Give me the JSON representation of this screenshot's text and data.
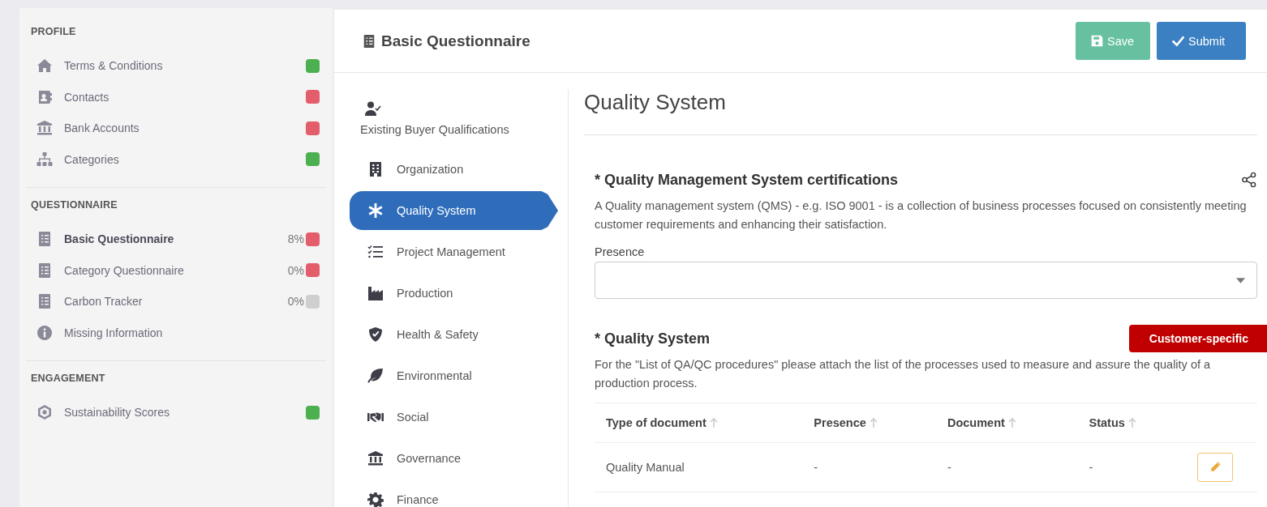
{
  "sidebar": {
    "sections": [
      {
        "title": "PROFILE",
        "items": [
          {
            "label": "Terms & Conditions",
            "selected": false,
            "color": "#4caf50"
          },
          {
            "label": "Contacts",
            "selected": false,
            "color": "#e35d6a"
          },
          {
            "label": "Bank Accounts",
            "selected": false,
            "color": "#e35d6a"
          },
          {
            "label": "Categories",
            "selected": false,
            "color": "#4caf50"
          }
        ]
      },
      {
        "title": "QUESTIONNAIRE",
        "items": [
          {
            "label": "Basic Questionnaire",
            "selected": true,
            "percent": "8%",
            "color": "#e35d6a"
          },
          {
            "label": "Category Questionnaire",
            "selected": false,
            "percent": "0%",
            "color": "#e35d6a"
          },
          {
            "label": "Carbon Tracker",
            "selected": false,
            "percent": "0%",
            "color": "#cfcfcf"
          },
          {
            "label": "Missing Information",
            "selected": false
          }
        ]
      },
      {
        "title": "ENGAGEMENT",
        "items": [
          {
            "label": "Sustainability Scores",
            "selected": false,
            "color": "#4caf50"
          }
        ]
      }
    ]
  },
  "header": {
    "title": "Basic Questionnaire",
    "buttons": [
      {
        "kind": "save",
        "label": "Save"
      },
      {
        "kind": "submit",
        "label": "Submit"
      }
    ]
  },
  "nav": [
    {
      "kind": "stacked",
      "label": "Existing Buyer Qualifications",
      "selected": false
    },
    {
      "kind": "row",
      "label": "Organization",
      "selected": false
    },
    {
      "kind": "row",
      "label": "Quality System",
      "selected": true
    },
    {
      "kind": "row",
      "label": "Project Management",
      "selected": false
    },
    {
      "kind": "row",
      "label": "Production",
      "selected": false
    },
    {
      "kind": "row",
      "label": "Health & Safety",
      "selected": false
    },
    {
      "kind": "row",
      "label": "Environmental",
      "selected": false
    },
    {
      "kind": "row",
      "label": "Social",
      "selected": false
    },
    {
      "kind": "row",
      "label": "Governance",
      "selected": false
    },
    {
      "kind": "row",
      "label": "Finance",
      "selected": false
    }
  ],
  "content": {
    "title": "Quality System",
    "sections": [
      {
        "title": "* Quality Management System certifications",
        "description": "A Quality management system (QMS) - e.g. ISO 9001 - is a collection of business processes focused on consistently meeting customer requirements and enhancing their satisfaction.",
        "field": {
          "label": "Presence"
        }
      },
      {
        "title": "* Quality System",
        "badge": "Customer-specific",
        "description": "For the \"List of QA/QC procedures\" please attach the list of the processes used to measure and assure the quality of a production process.",
        "table": {
          "columns": [
            "Type of document",
            "Presence",
            "Document",
            "Status"
          ],
          "rows": [
            [
              "Quality Manual",
              "-",
              "-",
              "-"
            ]
          ]
        }
      }
    ]
  }
}
